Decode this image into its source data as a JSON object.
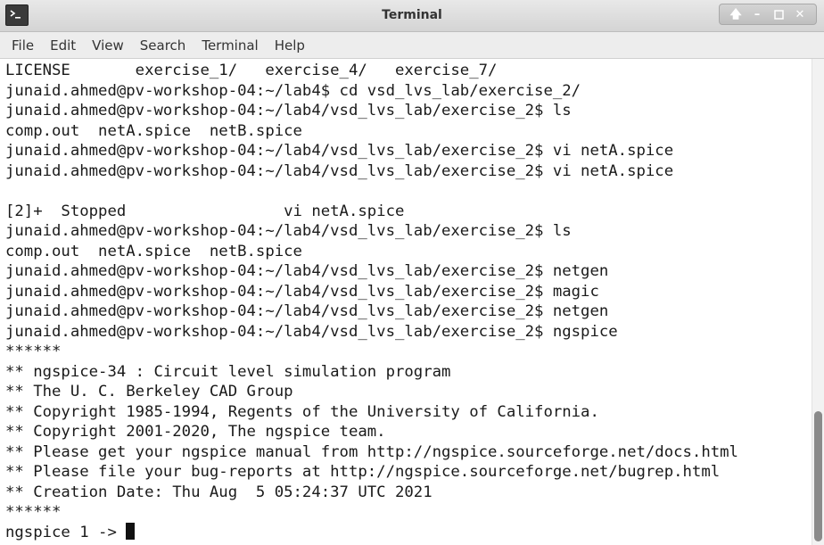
{
  "window": {
    "title": "Terminal"
  },
  "menu": {
    "items": [
      {
        "label": "File"
      },
      {
        "label": "Edit"
      },
      {
        "label": "View"
      },
      {
        "label": "Search"
      },
      {
        "label": "Terminal"
      },
      {
        "label": "Help"
      }
    ]
  },
  "terminal": {
    "lines": [
      "LICENSE       exercise_1/   exercise_4/   exercise_7/",
      "junaid.ahmed@pv-workshop-04:~/lab4$ cd vsd_lvs_lab/exercise_2/",
      "junaid.ahmed@pv-workshop-04:~/lab4/vsd_lvs_lab/exercise_2$ ls",
      "comp.out  netA.spice  netB.spice",
      "junaid.ahmed@pv-workshop-04:~/lab4/vsd_lvs_lab/exercise_2$ vi netA.spice",
      "junaid.ahmed@pv-workshop-04:~/lab4/vsd_lvs_lab/exercise_2$ vi netA.spice",
      "",
      "[2]+  Stopped                 vi netA.spice",
      "junaid.ahmed@pv-workshop-04:~/lab4/vsd_lvs_lab/exercise_2$ ls",
      "comp.out  netA.spice  netB.spice",
      "junaid.ahmed@pv-workshop-04:~/lab4/vsd_lvs_lab/exercise_2$ netgen",
      "junaid.ahmed@pv-workshop-04:~/lab4/vsd_lvs_lab/exercise_2$ magic",
      "junaid.ahmed@pv-workshop-04:~/lab4/vsd_lvs_lab/exercise_2$ netgen",
      "junaid.ahmed@pv-workshop-04:~/lab4/vsd_lvs_lab/exercise_2$ ngspice",
      "******",
      "** ngspice-34 : Circuit level simulation program",
      "** The U. C. Berkeley CAD Group",
      "** Copyright 1985-1994, Regents of the University of California.",
      "** Copyright 2001-2020, The ngspice team.",
      "** Please get your ngspice manual from http://ngspice.sourceforge.net/docs.html",
      "** Please file your bug-reports at http://ngspice.sourceforge.net/bugrep.html",
      "** Creation Date: Thu Aug  5 05:24:37 UTC 2021",
      "******"
    ],
    "prompt": "ngspice 1 -> "
  }
}
